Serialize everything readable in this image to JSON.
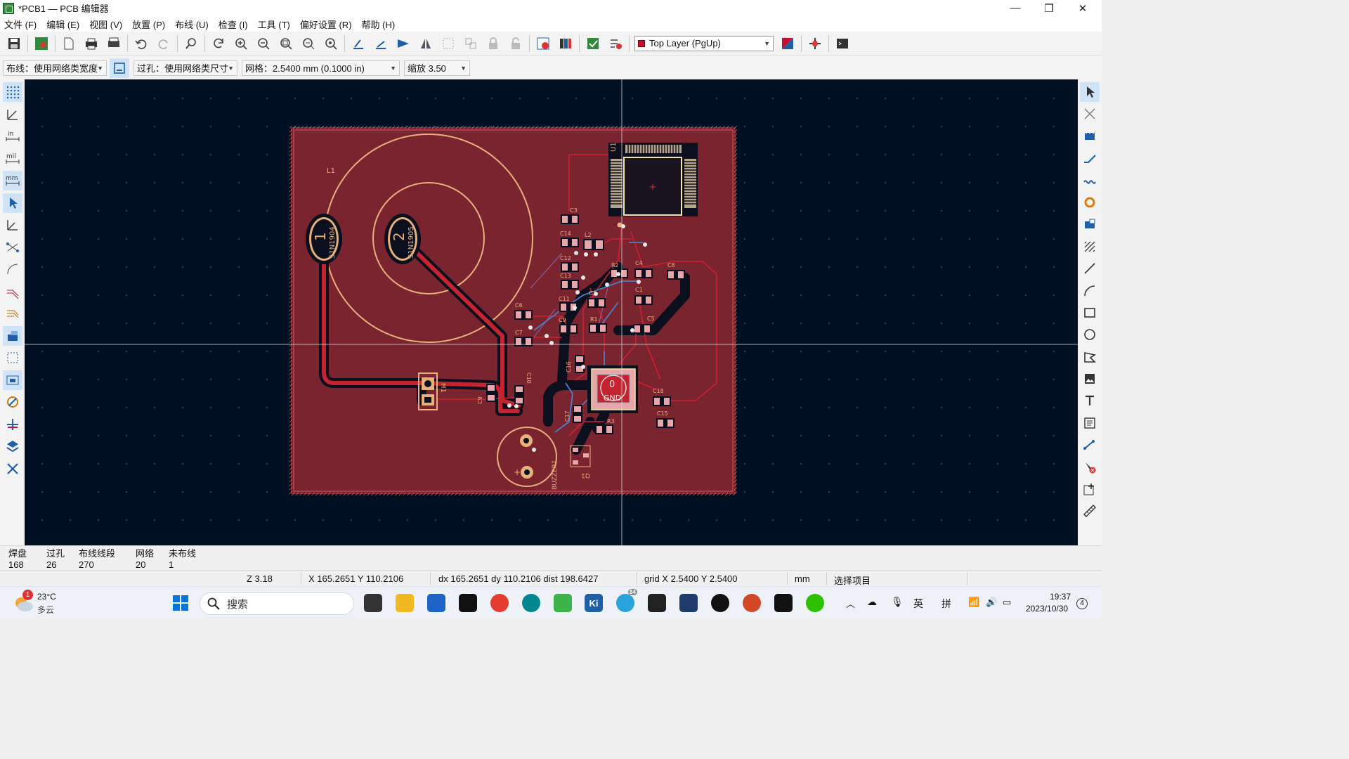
{
  "window": {
    "title": "*PCB1 — PCB 编辑器",
    "minimize": "—",
    "maximize": "❐",
    "close": "✕"
  },
  "menu": [
    "文件 (F)",
    "编辑 (E)",
    "视图 (V)",
    "放置 (P)",
    "布线 (U)",
    "检查 (I)",
    "工具 (T)",
    "偏好设置 (R)",
    "帮助 (H)"
  ],
  "toolbar": {
    "layer_selector": "Top Layer (PgUp)"
  },
  "toolbar2": {
    "track_width": "布线：使用网络类宽度",
    "via_size": "过孔：使用网络类尺寸",
    "grid": "网格：2.5400 mm (0.1000 in)",
    "zoom": "缩放 3.50"
  },
  "left_tools": [
    "grid-icon",
    "polar-coords-icon",
    "inches-icon",
    "mils-icon",
    "millimeters-icon",
    "cursor-icon",
    "angle-icon",
    "ratsnest-icon",
    "curved-ratsnest-icon",
    "track-outline-icon",
    "via-outline-icon",
    "zone-fill-icon",
    "zone-outline-icon",
    "high-contrast-icon",
    "footprint-text-icon",
    "net-highlight-icon",
    "layers-manager-icon",
    "properties-icon"
  ],
  "right_tools": [
    "select-icon",
    "local-ratsnest-icon",
    "footprint-add-icon",
    "route-track-icon",
    "route-diff-pair-icon",
    "tune-length-icon",
    "add-via-icon",
    "add-zone-icon",
    "add-keepout-icon",
    "draw-line-icon",
    "draw-arc-icon",
    "draw-rectangle-icon",
    "draw-circle-icon",
    "draw-polygon-icon",
    "add-image-icon",
    "add-text-icon",
    "add-textbox-icon",
    "add-dimension-icon",
    "delete-icon",
    "set-origin-icon",
    "measure-icon"
  ],
  "pcb": {
    "refs": {
      "L1": "L1",
      "pad1": "1",
      "pad2": "2",
      "net1": "S1N1904",
      "net2": "S1N1905",
      "H1": "H1",
      "U1": "U1",
      "buzzer": "BUZZER1",
      "Q1": "Q1",
      "C3": "C3",
      "C14": "C14",
      "L2": "L2",
      "R2": "R2",
      "C4": "C4",
      "C8": "C8",
      "C12": "C12",
      "C13": "C13",
      "C1": "C1",
      "C2": "C2",
      "C6": "C6",
      "C11": "C11",
      "R1": "R1",
      "C5": "C5",
      "C7": "C7",
      "C16": "C16",
      "C10": "C10",
      "C9": "C9",
      "C17": "C17",
      "C18": "C18",
      "C15": "C15",
      "R3": "R3",
      "gnd_num": "0",
      "gnd_label": "GND",
      "plus": "+"
    }
  },
  "stats": [
    {
      "label": "焊盘",
      "value": "168"
    },
    {
      "label": "过孔",
      "value": "26"
    },
    {
      "label": "布线线段",
      "value": "270"
    },
    {
      "label": "网络",
      "value": "20"
    },
    {
      "label": "未布线",
      "value": "1"
    }
  ],
  "status": {
    "zoom": "Z 3.18",
    "xy": "X 165.2651  Y 110.2106",
    "delta": "dx 165.2651  dy 110.2106  dist 198.6427",
    "grid": "grid X 2.5400  Y 2.5400",
    "units": "mm",
    "mode": "选择项目"
  },
  "taskbar": {
    "weather_temp": "23°C",
    "weather_desc": "多云",
    "weather_badge": "1",
    "search": "搜索",
    "telegram_badge": "84",
    "ime1": "英",
    "ime2": "拼",
    "time": "19:37",
    "date": "2023/10/30",
    "notif": "4"
  },
  "colors": {
    "board": "#7a2430",
    "canvas": "#001023",
    "top_track": "#c4232f",
    "bottom_track": "#4d7fc4",
    "silk": "#e8b07a",
    "pad": "#c8102e"
  }
}
